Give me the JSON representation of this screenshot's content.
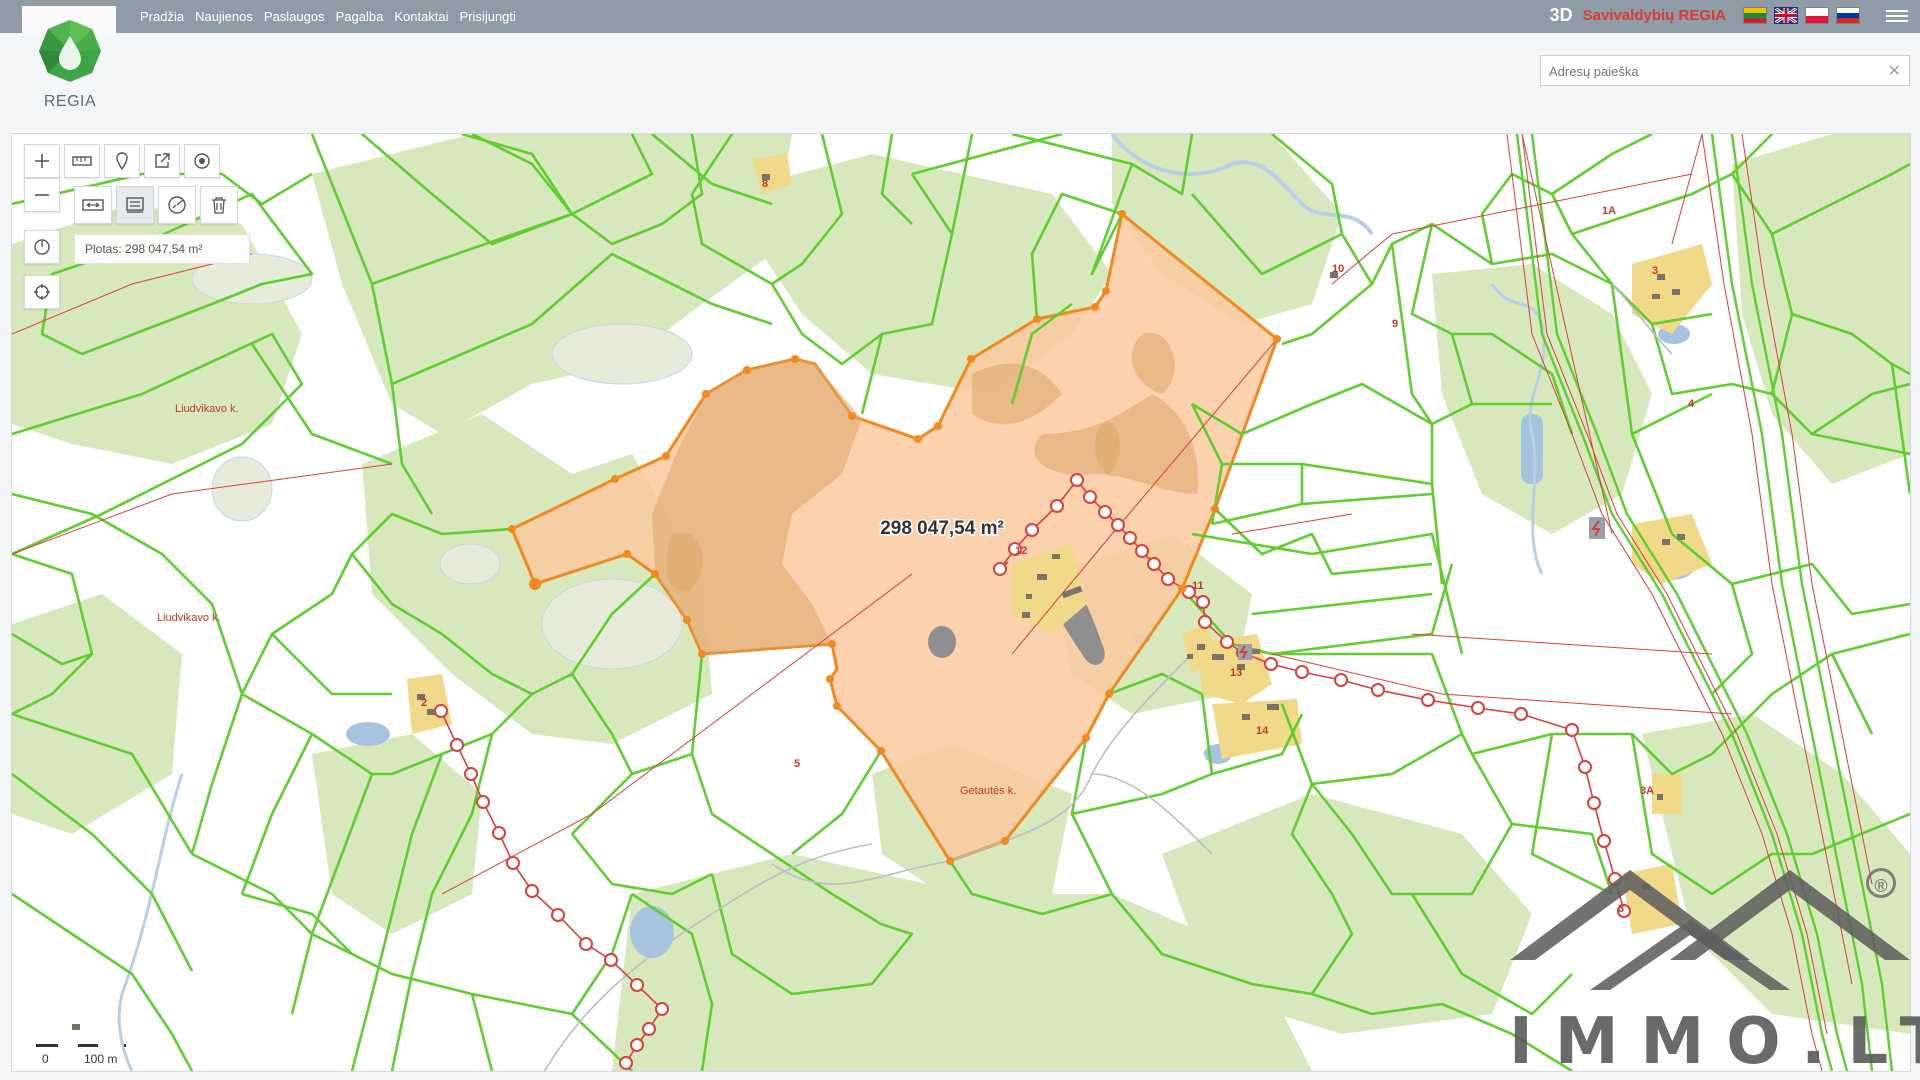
{
  "header": {
    "nav": [
      "Pradžia",
      "Naujienos",
      "Paslaugos",
      "Pagalba",
      "Kontaktai",
      "Prisijungti"
    ],
    "btn_3d": "3D",
    "regia_link": "Savivaldybių REGIA",
    "flags": [
      "lt-flag",
      "uk-flag",
      "pl-flag",
      "ru-flag"
    ]
  },
  "logo": {
    "text": "REGIA"
  },
  "search": {
    "placeholder": "Adresų paieška",
    "value": ""
  },
  "map": {
    "area_info": "Plotas: 298 047,54 m²",
    "area_label": "298 047,54 m²",
    "places": [
      {
        "id": "liudvikavo-1",
        "text": "Liudvikavo k."
      },
      {
        "id": "liudvikavo-2",
        "text": "Liudvikavo k."
      },
      {
        "id": "getautes",
        "text": "Getautės k."
      }
    ],
    "parcel_numbers": [
      "8",
      "10",
      "9",
      "12",
      "11",
      "13",
      "14",
      "2",
      "5",
      "1A",
      "3",
      "4",
      "3A",
      "3"
    ],
    "scale": {
      "zero": "0",
      "distance": "100 m"
    },
    "colors": {
      "parcel_line": "#5fce2f",
      "forest": "#d8e8bd",
      "selection_fill": "#fcc9a0",
      "selection_line": "#f08a1f",
      "powerline": "#d9403c",
      "water": "#a8c3e0",
      "building_area": "#f1d98a"
    }
  },
  "watermark": {
    "text": "IMMO.LT",
    "registered": "®"
  }
}
